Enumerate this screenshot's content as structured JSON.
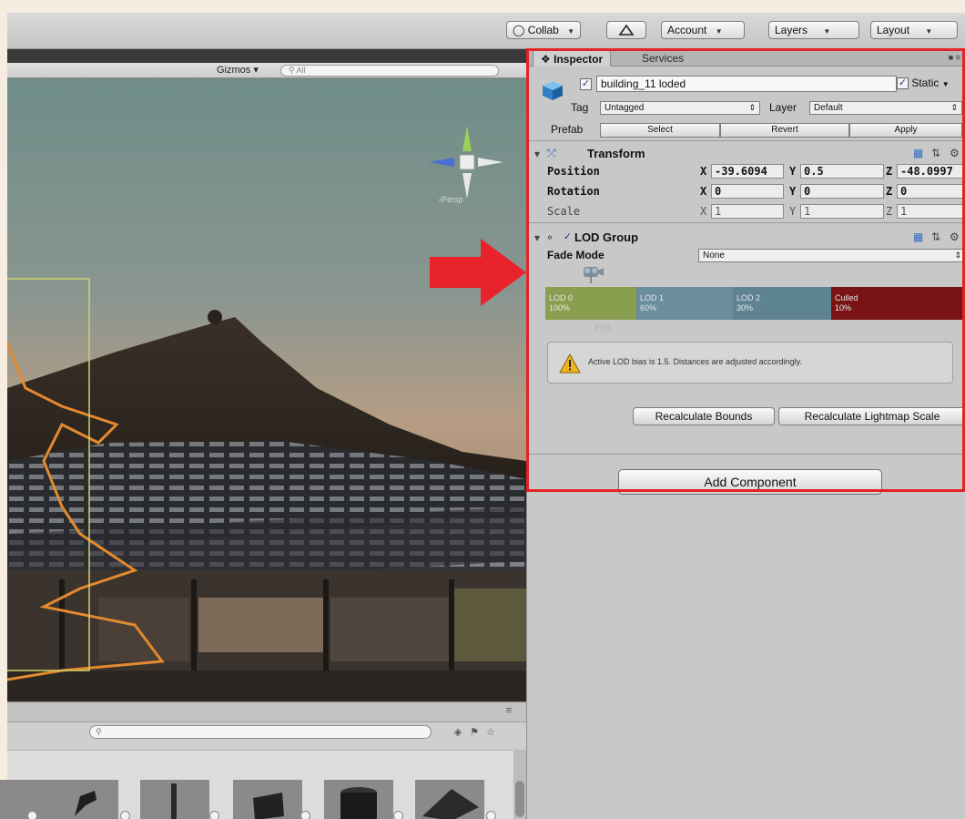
{
  "toolbar": {
    "collab": "Collab",
    "account": "Account",
    "layers": "Layers",
    "layout": "Layout"
  },
  "scene": {
    "gizmos_label": "Gizmos",
    "search_placeholder": "All",
    "persp_label": "‹Persp"
  },
  "inspector": {
    "tabs": [
      "Inspector",
      "Services"
    ],
    "object": {
      "active": true,
      "name": "building_11 loded",
      "static_label": "Static",
      "tag_label": "Tag",
      "tag_value": "Untagged",
      "layer_label": "Layer",
      "layer_value": "Default",
      "prefab_label": "Prefab",
      "prefab_buttons": [
        "Select",
        "Revert",
        "Apply"
      ]
    },
    "transform": {
      "title": "Transform",
      "position_label": "Position",
      "rotation_label": "Rotation",
      "scale_label": "Scale",
      "axis_labels": [
        "X",
        "Y",
        "Z"
      ],
      "position": [
        "-39.6094",
        "0.5",
        "-48.0997"
      ],
      "rotation": [
        "0",
        "0",
        "0"
      ],
      "scale": [
        "1",
        "1",
        "1"
      ]
    },
    "lod_group": {
      "title": "LOD Group",
      "fade_mode_label": "Fade Mode",
      "fade_mode_value": "None",
      "levels": [
        {
          "name": "LOD 0",
          "percent": "100%",
          "color": "#8a9e50"
        },
        {
          "name": "LOD 1",
          "percent": "60%",
          "color": "#6a8e9e"
        },
        {
          "name": "LOD 2",
          "percent": "30%",
          "color": "#5e8494"
        },
        {
          "name": "Culled",
          "percent": "10%",
          "color": "#7a1414"
        }
      ],
      "cursor_percent": "81%",
      "warning": "Active LOD bias is 1.5. Distances are adjusted accordingly.",
      "recalc_bounds": "Recalculate Bounds",
      "recalc_lightmap": "Recalculate Lightmap Scale"
    },
    "add_component": "Add Component"
  },
  "colors": {
    "highlight": "#e22424",
    "arrow": "#e8232b"
  }
}
